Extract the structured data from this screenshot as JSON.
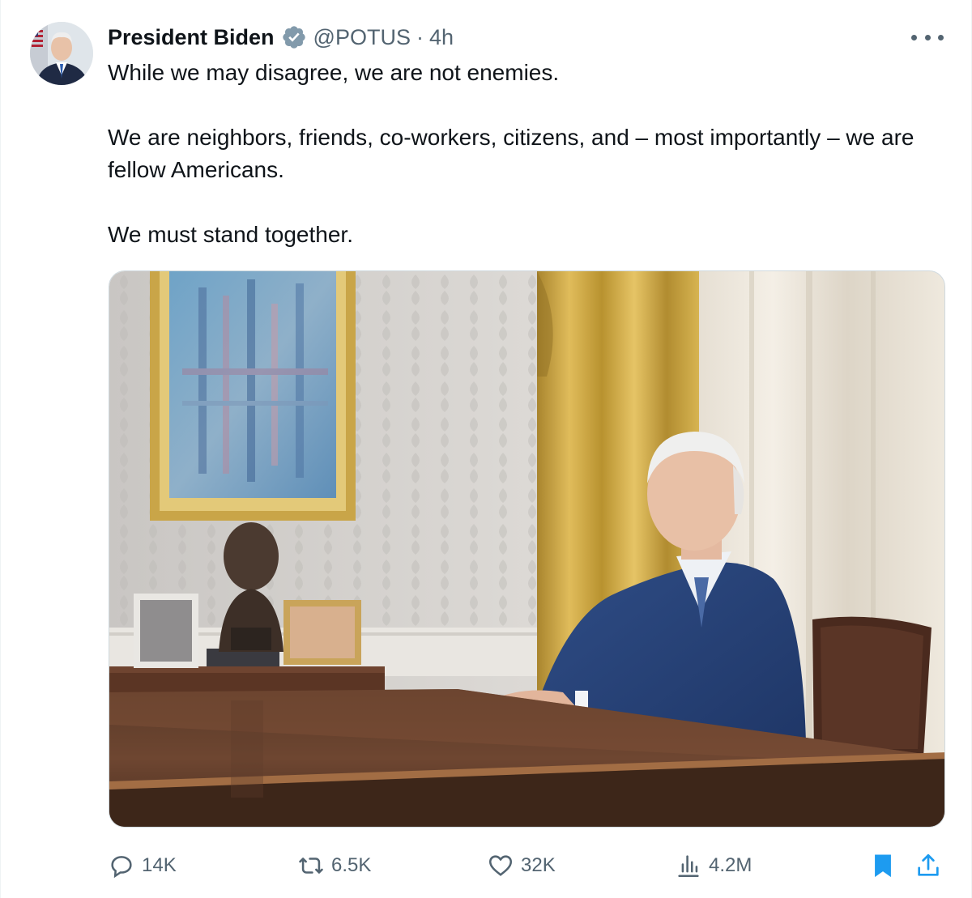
{
  "author": {
    "name": "President Biden",
    "handle": "@POTUS",
    "separator": "·",
    "time": "4h",
    "verified_icon": "verified-badge-icon"
  },
  "tweet": {
    "paragraphs": [
      "While we may disagree, we are not enemies.",
      "We are neighbors, friends, co-workers, citizens, and – most importantly – we are fellow Americans.",
      "We must stand together."
    ]
  },
  "actions": {
    "replies": "14K",
    "reposts": "6.5K",
    "likes": "32K",
    "views": "4.2M"
  },
  "colors": {
    "text": "#0f1419",
    "secondary": "#536471",
    "bookmark_active": "#1d9bf0",
    "verified_badge": "#829aab"
  }
}
